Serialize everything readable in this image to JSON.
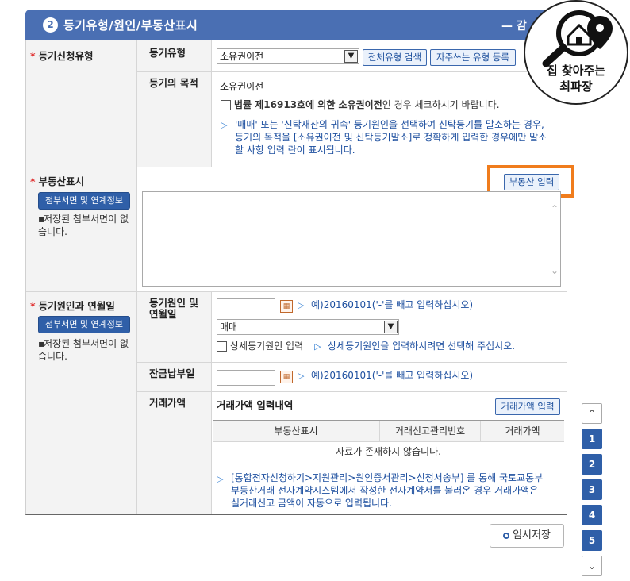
{
  "section": {
    "number": "2",
    "title": "등기유형/원인/부동산표시",
    "collapse_label": "— 감"
  },
  "registration_type": {
    "label": "등기신청유형",
    "type_label": "등기유형",
    "type_value": "소유권이전",
    "search_all_btn": "전체유형 검색",
    "favorites_btn": "자주쓰는 유형 등록",
    "purpose_label": "등기의 목적",
    "purpose_value": "소유권이전",
    "law_check_bold": "법률 제16913호에 의한 소유권이전",
    "law_check_rest": "인 경우 체크하시기 바랍니다.",
    "trust_note": "'매매' 또는 '신탁재산의 귀속' 등기원인을 선택하여 신탁등기를 말소하는 경우, 등기의 목적을 [소유권이전 및 신탁등기말소]로 정확하게 입력한 경우에만 말소할 사항 입력 란이 표시됩니다."
  },
  "property": {
    "label": "부동산표시",
    "attach_btn": "첨부서면 및 연계정보",
    "no_saved": "저장된 첨부서면이 없습니다.",
    "input_btn": "부동산 입력"
  },
  "cause": {
    "label": "등기원인과 연월일",
    "attach_btn": "첨부서면 및 연계정보",
    "no_saved": "저장된 첨부서면이 없습니다.",
    "cause_label": "등기원인 및 연월일",
    "date_hint": "예)20160101('-'를 빼고 입력하십시오)",
    "cause_value": "매매",
    "detail_check": "상세등기원인 입력",
    "detail_hint": "상세등기원인을 입력하시려면 선택해 주십시오.",
    "balance_label": "잔금납부일",
    "balance_hint": "예)20160101('-'를 빼고 입력하십시오)"
  },
  "price": {
    "label": "거래가액",
    "title": "거래가액 입력내역",
    "input_btn": "거래가액 입력",
    "columns": [
      "부동산표시",
      "거래신고관리번호",
      "거래가액"
    ],
    "empty": "자료가 존재하지 않습니다.",
    "note": "[통합전자신청하기>지원관리>원인증서관리>신청서송부] 를 통해 국토교통부 부동산거래 전자계약시스템에서 작성한 전자계약서를 불러온 경우 거래가액은 실거래신고 금액이 자동으로 입력됩니다."
  },
  "save_btn": "임시저장",
  "side_nav": {
    "up": "^",
    "pages": [
      "1",
      "2",
      "3",
      "4",
      "5"
    ],
    "down": "v"
  },
  "logo": {
    "line1": "집 찾아주는",
    "line2": "최파장"
  },
  "colors": {
    "header": "#4a6fb3",
    "highlight": "#f07c1c",
    "button": "#2f5fa8"
  }
}
